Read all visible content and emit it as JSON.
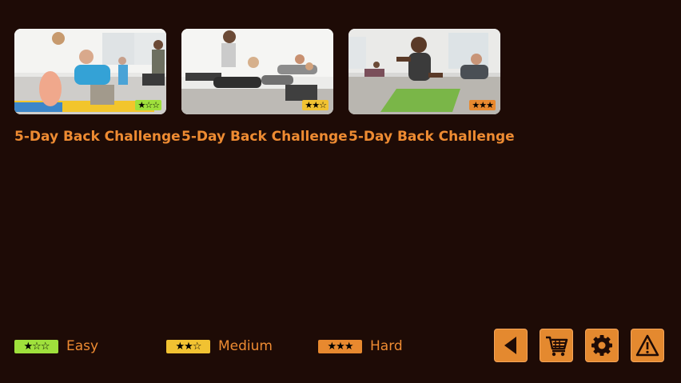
{
  "colors": {
    "background": "#1e0b06",
    "accent": "#ee8b32",
    "easy": "#9fe03c",
    "medium": "#f1c232",
    "hard": "#e8892f"
  },
  "cards": [
    {
      "title": "5-Day Back Challenge",
      "difficulty": "easy",
      "stars": "★☆☆",
      "rating": 1
    },
    {
      "title": "5-Day Back Challenge",
      "difficulty": "medium",
      "stars": "★★☆",
      "rating": 2
    },
    {
      "title": "5-Day Back Challenge",
      "difficulty": "hard",
      "stars": "★★★",
      "rating": 3
    }
  ],
  "legend": [
    {
      "stars": "★☆☆",
      "label": "Easy"
    },
    {
      "stars": "★★☆",
      "label": "Medium"
    },
    {
      "stars": "★★★",
      "label": "Hard"
    }
  ],
  "toolbar": {
    "buttons": [
      {
        "icon": "back-arrow-icon"
      },
      {
        "icon": "cart-icon"
      },
      {
        "icon": "gear-icon"
      },
      {
        "icon": "warning-icon"
      }
    ]
  }
}
